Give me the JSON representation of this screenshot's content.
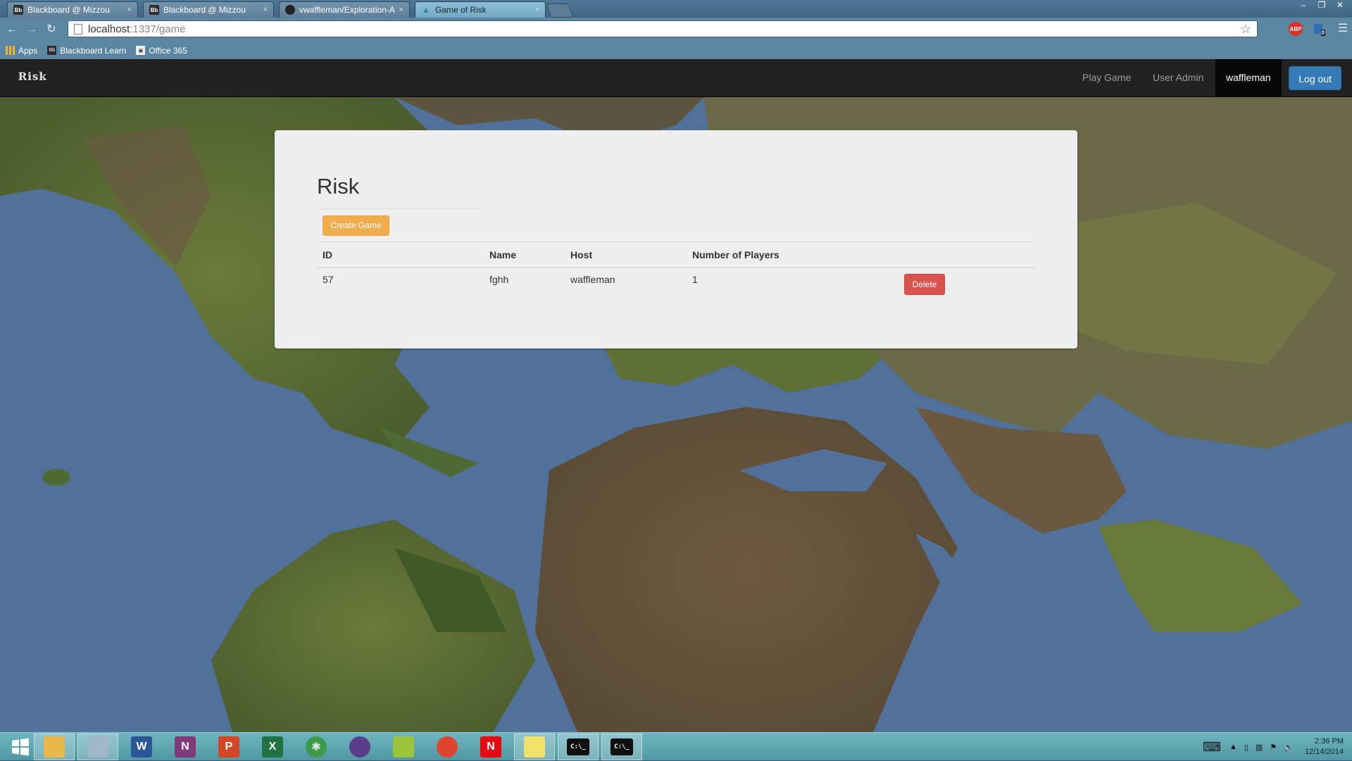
{
  "browser": {
    "tabs": [
      {
        "favicon": "Bb",
        "title": "Blackboard @ Mizzou",
        "active": false
      },
      {
        "favicon": "Bb",
        "title": "Blackboard @ Mizzou",
        "active": false
      },
      {
        "favicon": "github",
        "title": "vwaffleman/Exploration-A",
        "active": false
      },
      {
        "favicon": "risk",
        "title": "Game of Risk",
        "active": true
      }
    ],
    "url_host": "localhost",
    "url_path": ":1337/game",
    "bookmarks": [
      {
        "icon": "apps-grid-icon",
        "label": "Apps"
      },
      {
        "icon": "blackboard-icon",
        "label": "Blackboard Learn"
      },
      {
        "icon": "office-icon",
        "label": "Office 365"
      }
    ],
    "extensions": [
      {
        "name": "adblock-icon",
        "text": "ABP",
        "color": "#d9302b"
      },
      {
        "name": "extension-badge-icon",
        "text": "0",
        "color": "#2b6fb0"
      }
    ]
  },
  "app": {
    "brand": "Risk",
    "nav": {
      "play_game": "Play Game",
      "user_admin": "User Admin",
      "username": "waffleman",
      "logout": "Log out"
    },
    "page_title": "Risk",
    "create_button": "Create Game",
    "table": {
      "headers": [
        "ID",
        "Name",
        "Host",
        "Number of Players"
      ],
      "rows": [
        {
          "id": "57",
          "name": "fghh",
          "host": "waffleman",
          "players": "1",
          "action": "Delete"
        }
      ]
    }
  },
  "taskbar": {
    "apps": [
      {
        "name": "windows-start-icon",
        "label": "",
        "color": "#ffffff"
      },
      {
        "name": "file-explorer-icon",
        "label": "",
        "color": "#e8b84a"
      },
      {
        "name": "calculator-icon",
        "label": "",
        "color": "#9fb7c9"
      },
      {
        "name": "word-icon",
        "label": "W",
        "color": "#2b579a"
      },
      {
        "name": "onenote-icon",
        "label": "N",
        "color": "#80397b"
      },
      {
        "name": "powerpoint-icon",
        "label": "P",
        "color": "#d24726"
      },
      {
        "name": "excel-icon",
        "label": "X",
        "color": "#217346"
      },
      {
        "name": "atom-icon",
        "label": "⚛",
        "color": "#3a9a4a"
      },
      {
        "name": "eclipse-icon",
        "label": "",
        "color": "#5a3d8c"
      },
      {
        "name": "notepad-plus-icon",
        "label": "",
        "color": "#9bc43c"
      },
      {
        "name": "chrome-icon",
        "label": "",
        "color": "#e0452f"
      },
      {
        "name": "netflix-icon",
        "label": "N",
        "color": "#e50914"
      },
      {
        "name": "sticky-notes-icon",
        "label": "",
        "color": "#f2e26b"
      },
      {
        "name": "terminal-icon",
        "label": "C:\\_",
        "color": "#111111"
      },
      {
        "name": "terminal-icon-2",
        "label": "C:\\_",
        "color": "#111111"
      }
    ],
    "time": "2:36 PM",
    "date": "12/14/2014"
  }
}
